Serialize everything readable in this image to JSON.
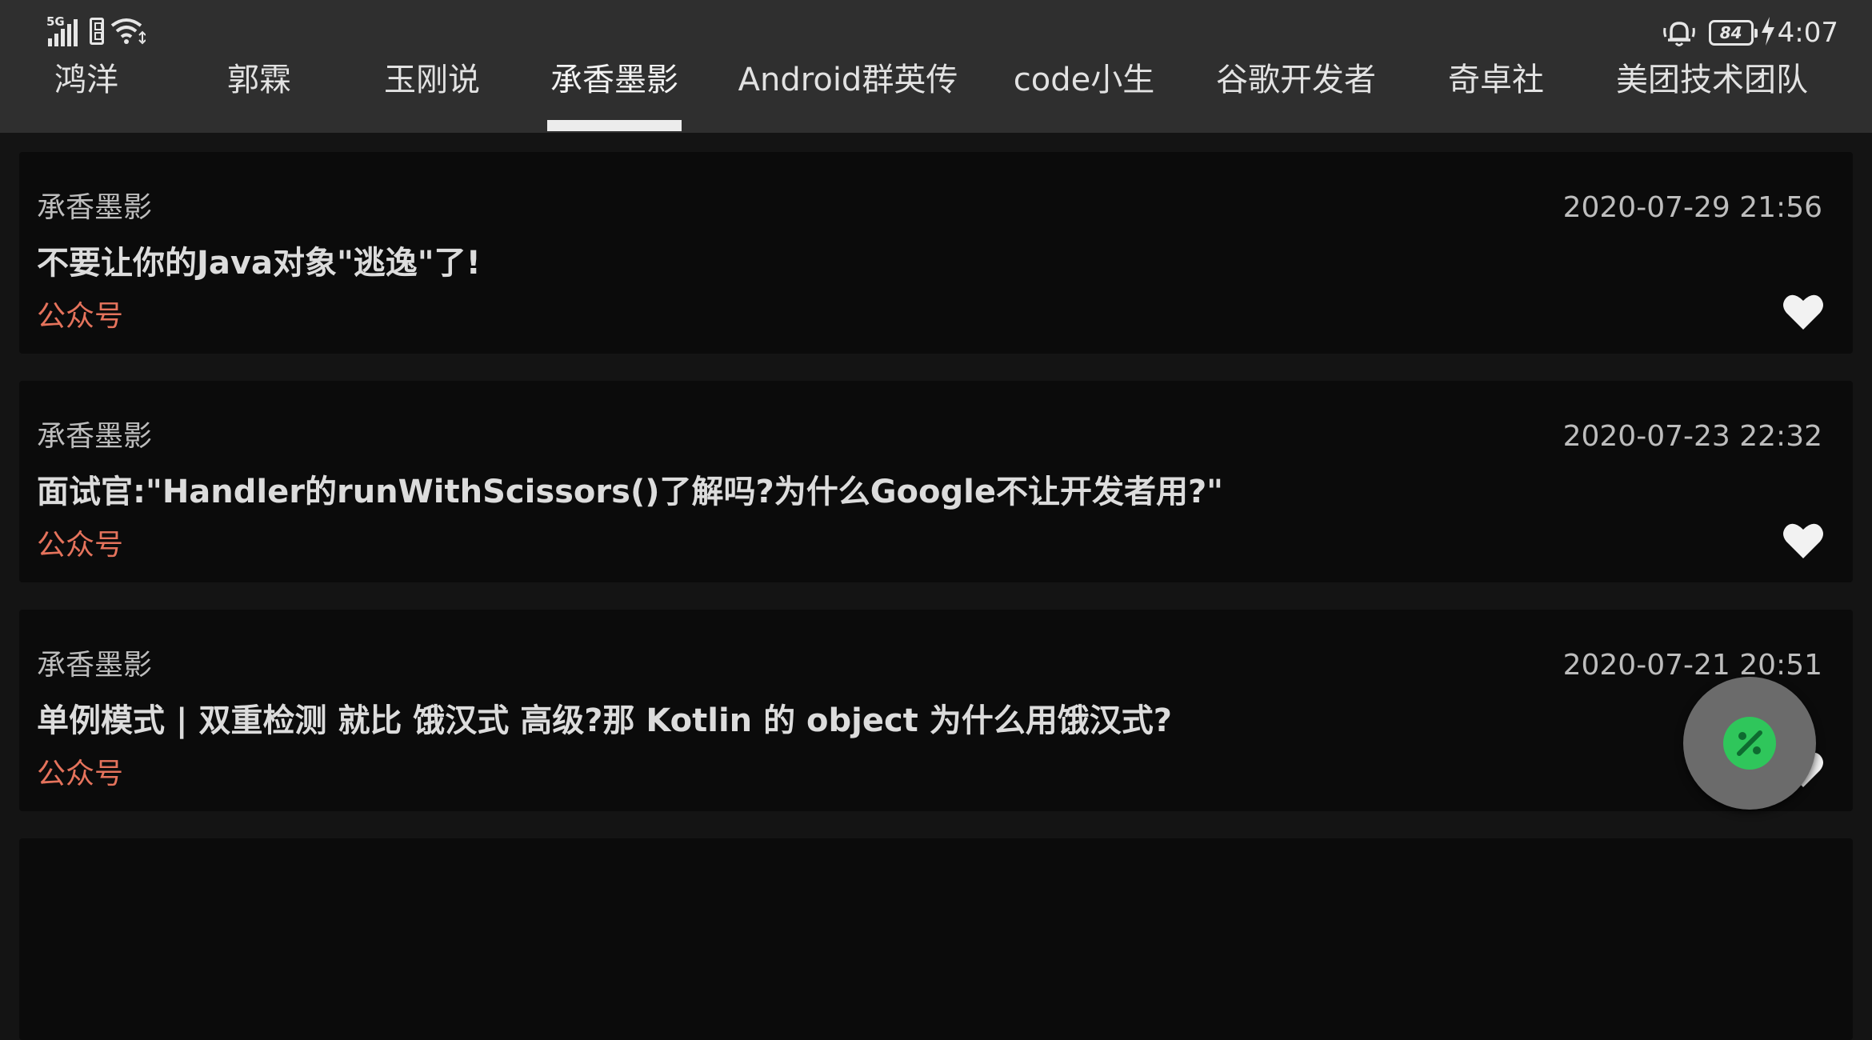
{
  "status_bar": {
    "network": "5G",
    "battery_level": "84",
    "time": "4:07",
    "icons": [
      "signal-icon",
      "sim-icon",
      "wifi-icon",
      "bell-icon",
      "battery-icon",
      "charging-icon"
    ]
  },
  "tabs": {
    "items": [
      {
        "label": "鸿洋"
      },
      {
        "label": "郭霖"
      },
      {
        "label": "玉刚说"
      },
      {
        "label": "承香墨影"
      },
      {
        "label": "Android群英传"
      },
      {
        "label": "code小生"
      },
      {
        "label": "谷歌开发者"
      },
      {
        "label": "奇卓社"
      },
      {
        "label": "美团技术团队"
      }
    ],
    "selected": "承香墨影"
  },
  "articles": [
    {
      "author": "承香墨影",
      "date": "2020-07-29 21:56",
      "title": "不要让你的Java对象\"逃逸\"了!",
      "tag": "公众号",
      "liked": true
    },
    {
      "author": "承香墨影",
      "date": "2020-07-23 22:32",
      "title": "面试官:\"Handler的runWithScissors()了解吗?为什么Google不让开发者用?\"",
      "tag": "公众号",
      "liked": true
    },
    {
      "author": "承香墨影",
      "date": "2020-07-21 20:51",
      "title": "单例模式 | 双重检测 就比 饿汉式 高级?那 Kotlin 的 object 为什么用饿汉式?",
      "tag": "公众号",
      "liked": true
    }
  ],
  "fab": {
    "icon": "theme-toggle-icon"
  },
  "colors": {
    "background": "#141414",
    "bar": "#2f2f2f",
    "card": "#0b0b0b",
    "tag": "#e5735c",
    "fab": "#6b6b6b",
    "fab_accent": "#2fc65b"
  }
}
